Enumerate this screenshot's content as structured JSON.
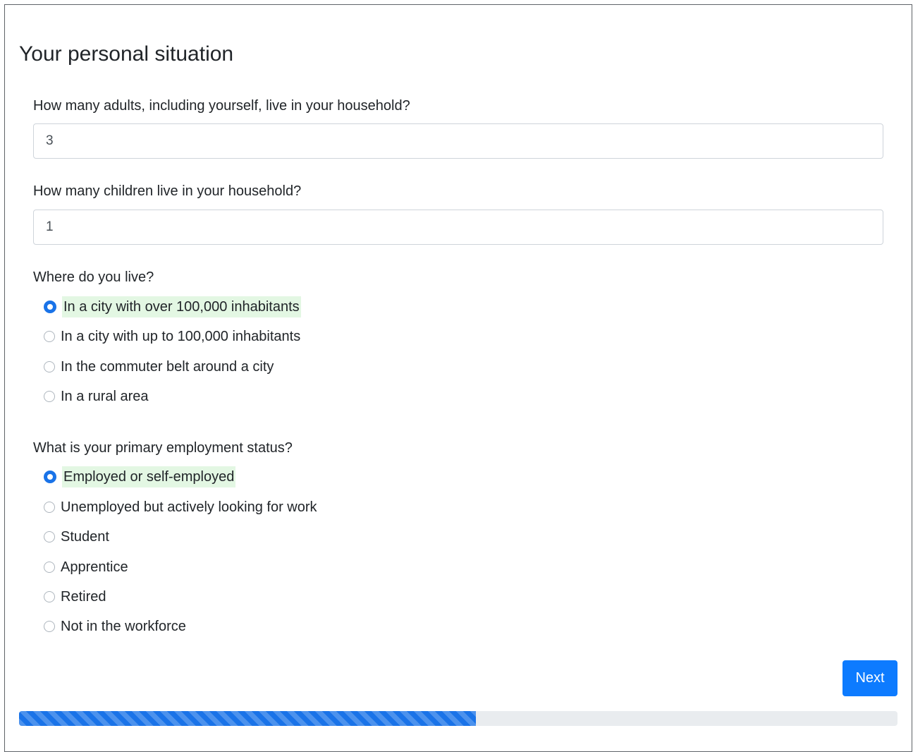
{
  "page": {
    "title": "Your personal situation"
  },
  "questions": {
    "adults": {
      "label": "How many adults, including yourself, live in your household?",
      "value": "3"
    },
    "children": {
      "label": "How many children live in your household?",
      "value": "1"
    },
    "location": {
      "label": "Where do you live?",
      "selected_index": 0,
      "options": [
        "In a city with over 100,000 inhabitants",
        "In a city with up to 100,000 inhabitants",
        "In the commuter belt around a city",
        "In a rural area"
      ]
    },
    "employment": {
      "label": "What is your primary employment status?",
      "selected_index": 0,
      "options": [
        "Employed or self-employed",
        "Unemployed but actively looking for work",
        "Student",
        "Apprentice",
        "Retired",
        "Not in the workforce"
      ]
    }
  },
  "actions": {
    "next_label": "Next"
  },
  "progress": {
    "fraction": 0.52
  },
  "colors": {
    "accent": "#1a73e8",
    "button": "#0d7bff",
    "selected_highlight": "#e3f7e3"
  }
}
